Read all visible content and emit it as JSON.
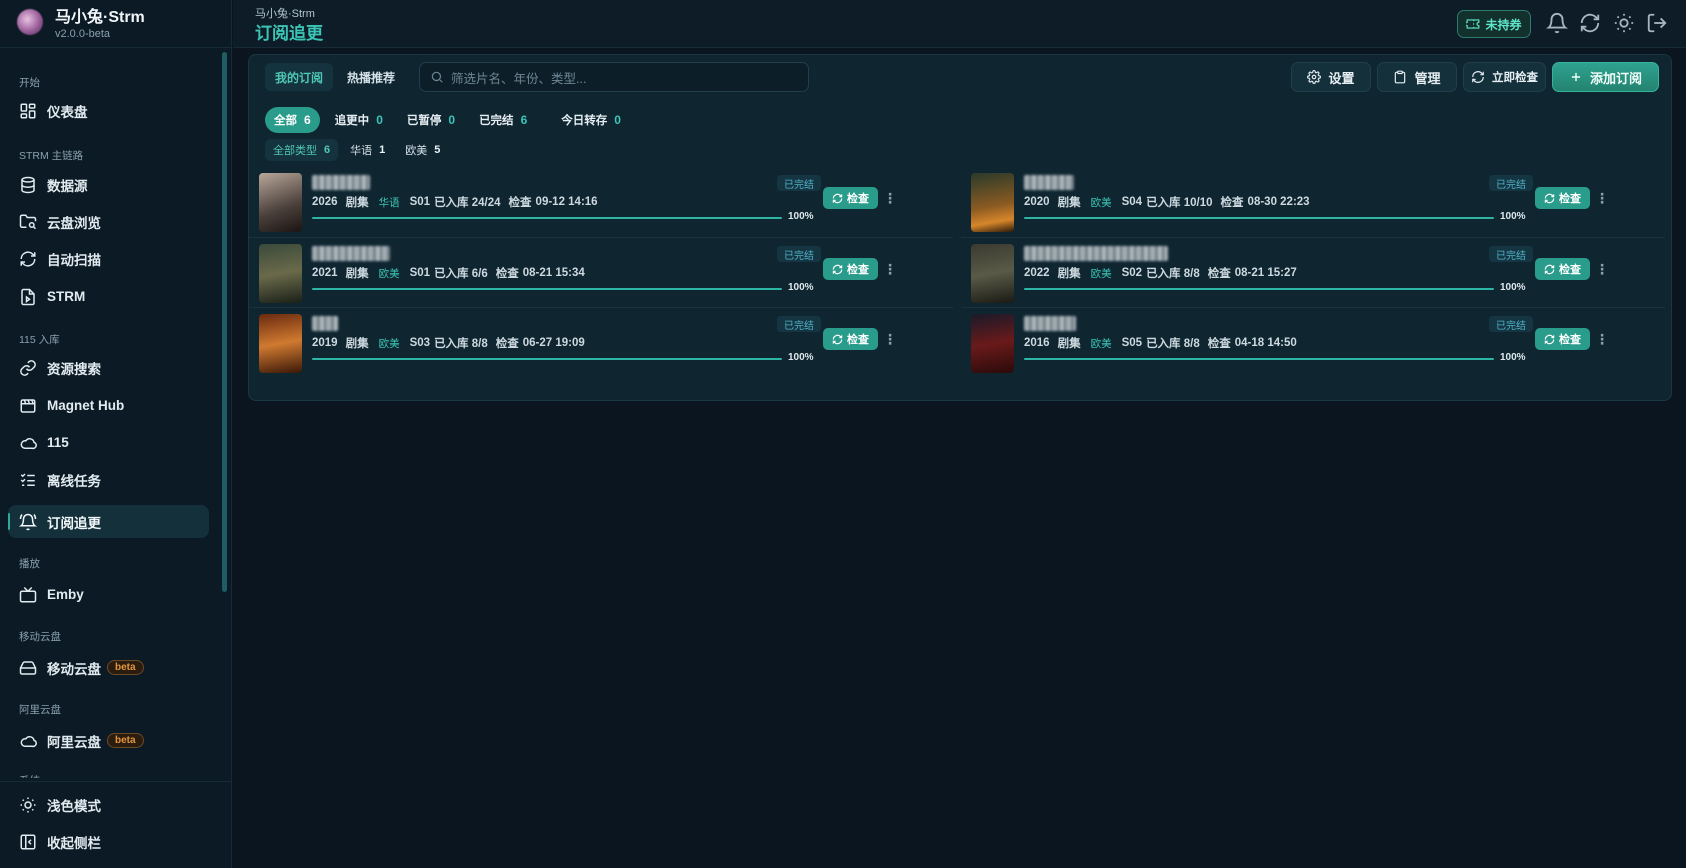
{
  "brand": {
    "name": "马小兔·Strm",
    "version": "v2.0.0-beta"
  },
  "nav": {
    "sections": [
      {
        "label": "开始",
        "items": [
          {
            "label": "仪表盘",
            "icon": "dashboard-icon"
          }
        ]
      },
      {
        "label": "STRM 主链路",
        "items": [
          {
            "label": "数据源",
            "icon": "database-icon"
          },
          {
            "label": "云盘浏览",
            "icon": "folder-search-icon"
          },
          {
            "label": "自动扫描",
            "icon": "refresh-icon"
          },
          {
            "label": "STRM",
            "icon": "file-play-icon"
          }
        ]
      },
      {
        "label": "115 入库",
        "items": [
          {
            "label": "资源搜索",
            "icon": "link-icon"
          },
          {
            "label": "Magnet Hub",
            "icon": "film-icon"
          },
          {
            "label": "115",
            "icon": "cloud-icon"
          },
          {
            "label": "离线任务",
            "icon": "checklist-icon"
          },
          {
            "label": "订阅追更",
            "icon": "bell-icon",
            "active": true
          }
        ]
      },
      {
        "label": "播放",
        "items": [
          {
            "label": "Emby",
            "icon": "tv-icon"
          }
        ]
      },
      {
        "label": "移动云盘",
        "items": [
          {
            "label": "移动云盘",
            "icon": "hard-drive-icon",
            "badge": "beta"
          }
        ]
      },
      {
        "label": "阿里云盘",
        "items": [
          {
            "label": "阿里云盘",
            "icon": "cloud-icon",
            "badge": "beta"
          }
        ]
      },
      {
        "label": "系统",
        "items": []
      }
    ],
    "bottom": [
      {
        "label": "浅色模式",
        "icon": "sun-icon"
      },
      {
        "label": "收起侧栏",
        "icon": "collapse-sidebar-icon"
      }
    ]
  },
  "header": {
    "crumb": "马小兔·Strm",
    "title": "订阅追更",
    "ticket_label": "未持券"
  },
  "toolbar": {
    "tabs": [
      "我的订阅",
      "热播推荐"
    ],
    "search_placeholder": "筛选片名、年份、类型...",
    "settings_label": "设置",
    "manage_label": "管理",
    "check_now_label": "立即检查",
    "add_label": "添加订阅"
  },
  "filters": [
    {
      "label": "全部",
      "count": "6"
    },
    {
      "label": "追更中",
      "count": "0"
    },
    {
      "label": "已暂停",
      "count": "0"
    },
    {
      "label": "已完结",
      "count": "6"
    },
    {
      "label": "今日转存",
      "count": "0"
    }
  ],
  "types": [
    {
      "label": "全部类型",
      "count": "6"
    },
    {
      "label": "华语",
      "count": "1"
    },
    {
      "label": "欧美",
      "count": "5"
    }
  ],
  "subscriptions": [
    {
      "year": "2026",
      "kind": "剧集",
      "region": "华语",
      "season": "S01",
      "progress_text": "已入库 24/24",
      "check_label": "检查",
      "checked": "09-12 14:16",
      "percent_label": "100%",
      "progress": 1.0,
      "status": "已完结",
      "button": "检查"
    },
    {
      "year": "2020",
      "kind": "剧集",
      "region": "欧美",
      "season": "S04",
      "progress_text": "已入库 10/10",
      "check_label": "检查",
      "checked": "08-30 22:23",
      "percent_label": "100%",
      "progress": 1.0,
      "status": "已完结",
      "button": "检查"
    },
    {
      "year": "2021",
      "kind": "剧集",
      "region": "欧美",
      "season": "S01",
      "progress_text": "已入库 6/6",
      "check_label": "检查",
      "checked": "08-21 15:34",
      "percent_label": "100%",
      "progress": 1.0,
      "status": "已完结",
      "button": "检查"
    },
    {
      "year": "2022",
      "kind": "剧集",
      "region": "欧美",
      "season": "S02",
      "progress_text": "已入库 8/8",
      "check_label": "检查",
      "checked": "08-21 15:27",
      "percent_label": "100%",
      "progress": 1.0,
      "status": "已完结",
      "button": "检查"
    },
    {
      "year": "2019",
      "kind": "剧集",
      "region": "欧美",
      "season": "S03",
      "progress_text": "已入库 8/8",
      "check_label": "检查",
      "checked": "06-27 19:09",
      "percent_label": "100%",
      "progress": 1.0,
      "status": "已完结",
      "button": "检查"
    },
    {
      "year": "2016",
      "kind": "剧集",
      "region": "欧美",
      "season": "S05",
      "progress_text": "已入库 8/8",
      "check_label": "检查",
      "checked": "04-18 14:50",
      "percent_label": "100%",
      "progress": 1.0,
      "status": "已完结",
      "button": "检查"
    }
  ],
  "colors": {
    "accent": "#3cc5b7",
    "primary_button": "#2a9c8b",
    "background": "#0a1520",
    "badge_beta": "#e4953c"
  }
}
